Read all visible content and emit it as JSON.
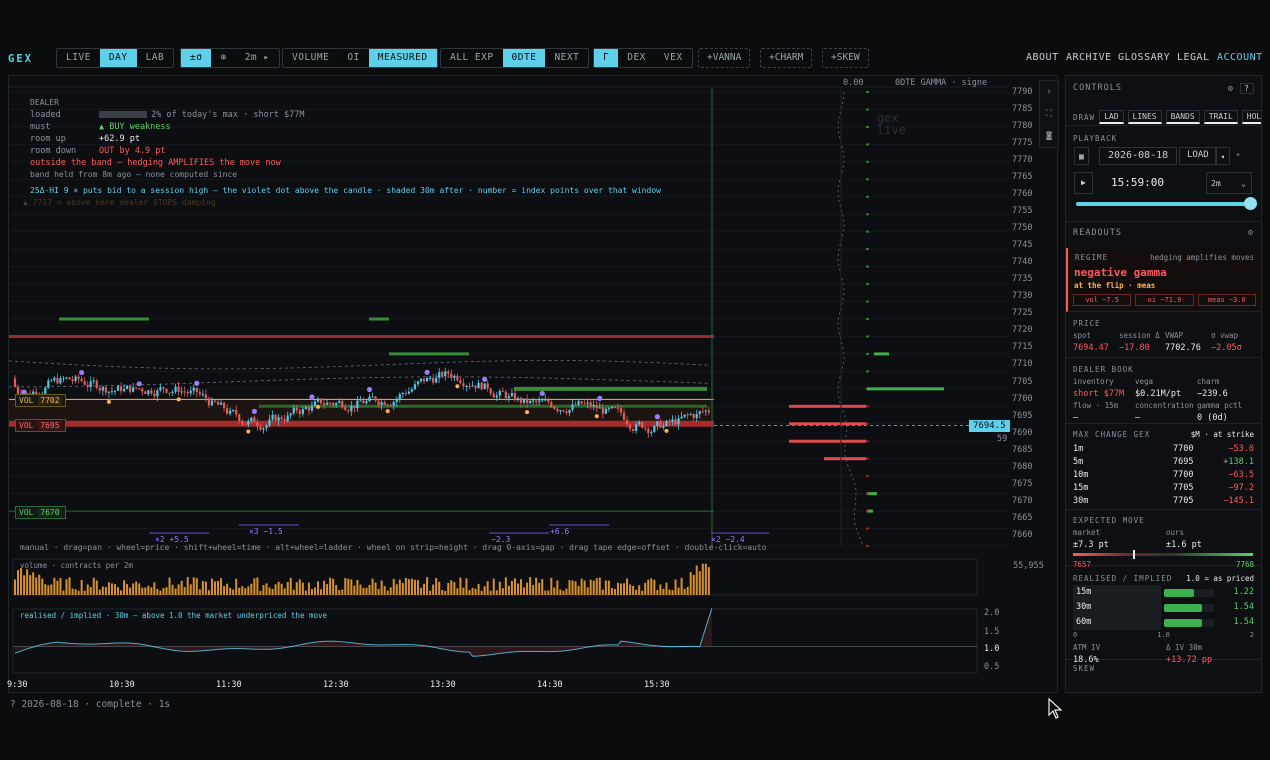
{
  "app": {
    "logo": "GEX",
    "status_bar": "? 2026-08-18 · complete · 1s"
  },
  "toolbar": {
    "mode": [
      "LIVE",
      "DAY",
      "LAB"
    ],
    "mode_active": "DAY",
    "band": [
      "±σ",
      "⊕",
      "2m ▸"
    ],
    "source": [
      "VOLUME",
      "OI",
      "MEASURED"
    ],
    "source_active": "MEASURED",
    "expiry": [
      "ALL EXP",
      "0DTE",
      "NEXT"
    ],
    "expiry_active": "0DTE",
    "greek": [
      "Γ",
      "DEX",
      "VEX"
    ],
    "greek_active": "Γ",
    "overlays": [
      "+VANNA",
      "+CHARM",
      "+SKEW"
    ]
  },
  "nav": [
    "ABOUT",
    "ARCHIVE",
    "GLOSSARY",
    "LEGAL",
    "ACCOUNT"
  ],
  "chart": {
    "strip_header": {
      "zero": "0.00",
      "label": "0DTE GAMMA · signe"
    },
    "watermark": [
      "gex",
      "live"
    ],
    "dealer": {
      "title": "DEALER",
      "loaded_k": "loaded",
      "loaded_v": "2% of today's max · short $77M",
      "must_k": "must",
      "must_v": "▲ BUY weakness",
      "up_k": "room up",
      "up_v": "+62.9 pt",
      "down_k": "room down",
      "down_v": "OUT by 4.9 pt",
      "warn": "outside the band — hedging AMPLIFIES the move now",
      "held": "band held from 8m ago — none computed since",
      "hint": "25Δ-HI 9 × puts bid to a session high — the violet dot above the candle · shaded 30m after · number = index points over that window",
      "ghost": "▲ 7717 = above here dealer STOPS damping"
    },
    "y_ticks": [
      "7790",
      "7785",
      "7780",
      "7775",
      "7770",
      "7765",
      "7760",
      "7755",
      "7750",
      "7745",
      "7740",
      "7735",
      "7730",
      "7725",
      "7720",
      "7715",
      "7710",
      "7705",
      "7700",
      "7695",
      "7690",
      "7685",
      "7680",
      "7675",
      "7670",
      "7665",
      "7660"
    ],
    "price_tag": "7694.5",
    "price_sub": "59",
    "levels": {
      "vol1_label": "VOL",
      "vol1": "7702",
      "vol2_label": "VOL",
      "vol2": "7695",
      "vol3_label": "VOL",
      "vol3": "7670"
    },
    "window_marks": [
      {
        "t": "×2 +5.5"
      },
      {
        "t": "×3 −1.5"
      },
      {
        "t": "−2.3"
      },
      {
        "t": "+6.6"
      },
      {
        "t": "×2 −2.4"
      }
    ],
    "help": "manual · drag=pan · wheel=price · shift+wheel=time · alt+wheel=ladder · wheel on strip=height · drag 0-axis=gap · drag tape edge=offset · double-click=auto",
    "volume_label": "volume · contracts per 2m",
    "volume_max": "55,955",
    "ratio_label": "realised / implied · 30m   —   above 1.0 the market underpriced the move",
    "ratio_ticks": [
      "2.0",
      "1.5",
      "1.0",
      "0.5"
    ],
    "x_ticks": [
      "9:30",
      "10:30",
      "11:30",
      "12:30",
      "13:30",
      "14:30",
      "15:30"
    ]
  },
  "side": {
    "controls": "CONTROLS",
    "draw_label": "DRAW",
    "draw": [
      "LAD",
      "LINES",
      "BANDS",
      "TRAIL",
      "HOLD"
    ],
    "playback": "PLAYBACK",
    "date": "2026-08-18",
    "load": "LOAD",
    "time": "15:59:00",
    "interval": "2m",
    "readouts": "READOUTS",
    "regime_k": "REGIME",
    "regime_note": "hedging amplifies moves",
    "regime": "negative gamma",
    "regime_sub": "at the flip · meas",
    "regime_tags": [
      "vol −7.5",
      "oi −71.9",
      "meas −3.0"
    ],
    "price_h": "PRICE",
    "price_cols": [
      "spot",
      "session Δ",
      "VWAP",
      "σ vwap"
    ],
    "price_vals": [
      "7694.47",
      "−17.80",
      "7702.76",
      "−2.05σ"
    ],
    "book_h": "DEALER BOOK",
    "book_cols": [
      "inventory",
      "vega",
      "charm"
    ],
    "book_vals": [
      "short $77M",
      "$0.21M/pt",
      "−239.6"
    ],
    "book_cols2": [
      "flow · 15m",
      "concentration",
      "gamma pctl"
    ],
    "book_vals2": [
      "—",
      "—",
      "0 (0d)"
    ],
    "maxchg_h": "MAX CHANGE GEX",
    "maxchg_note": "$M · at strike",
    "maxchg": [
      {
        "w": "1m",
        "s": "7700",
        "v": "−53.0"
      },
      {
        "w": "5m",
        "s": "7695",
        "v": "+138.1"
      },
      {
        "w": "10m",
        "s": "7700",
        "v": "−63.5"
      },
      {
        "w": "15m",
        "s": "7705",
        "v": "−97.2"
      },
      {
        "w": "30m",
        "s": "7705",
        "v": "−145.1"
      }
    ],
    "em_h": "EXPECTED MOVE",
    "em_cols": [
      "market",
      "ours"
    ],
    "em_vals": [
      "±7.3 pt",
      "±1.6 pt"
    ],
    "em_range": [
      "7657",
      "7768"
    ],
    "ri_h": "REALISED / IMPLIED",
    "ri_note": "1.0 = as priced",
    "ri": [
      {
        "w": "15m",
        "v": "1.22",
        "f": 0.61
      },
      {
        "w": "30m",
        "v": "1.54",
        "f": 0.77
      },
      {
        "w": "60m",
        "v": "1.54",
        "f": 0.77
      }
    ],
    "ri_axis": [
      "0",
      "1.0",
      "2"
    ],
    "iv_cols": [
      "ATM IV",
      "Δ IV 30m"
    ],
    "iv_vals": [
      "18.6%",
      "+13.72 pp"
    ],
    "skew_h": "SKEW"
  }
}
